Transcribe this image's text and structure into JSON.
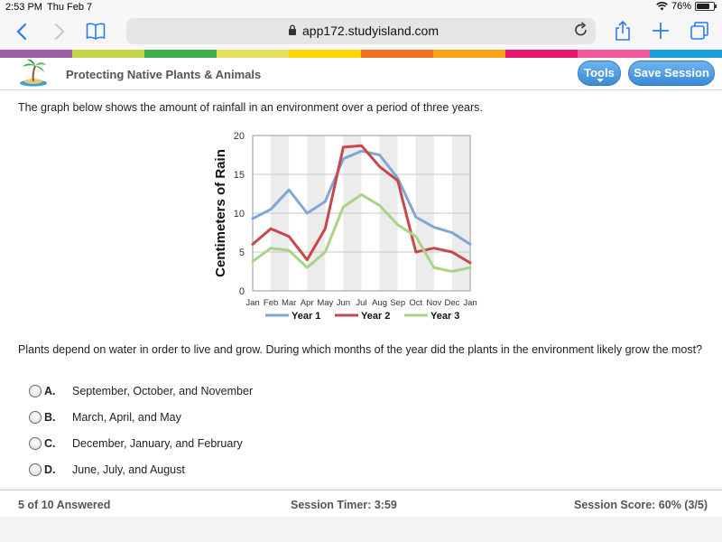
{
  "status": {
    "time": "2:53 PM",
    "date": "Thu Feb 7",
    "battery": "76%",
    "battery_level": 0.76
  },
  "browser": {
    "url": "app172.studyisland.com"
  },
  "stripe_colors": [
    "#9f5fa8",
    "#c5d649",
    "#3cb04a",
    "#e6e35b",
    "#ffd500",
    "#f37021",
    "#f7a21b",
    "#e6196e",
    "#f05a9b",
    "#1aa0d8"
  ],
  "app": {
    "title": "Protecting Native Plants & Animals",
    "tools_label": "Tools",
    "save_label": "Save Session"
  },
  "question": {
    "intro": "The graph below shows the amount of rainfall in an environment over a period of three years.",
    "prompt": "Plants depend on water in order to live and grow. During which months of the year did the plants in the environment likely grow the most?",
    "choices": [
      {
        "letter": "A.",
        "text": "September, October, and November"
      },
      {
        "letter": "B.",
        "text": "March, April, and May"
      },
      {
        "letter": "C.",
        "text": "December, January, and February"
      },
      {
        "letter": "D.",
        "text": "June, July, and August"
      }
    ]
  },
  "chart_data": {
    "type": "line",
    "categories": [
      "Jan",
      "Feb",
      "Mar",
      "Apr",
      "May",
      "Jun",
      "Jul",
      "Aug",
      "Sep",
      "Oct",
      "Nov",
      "Dec",
      "Jan"
    ],
    "ylabel": "Centimeters of Rain",
    "xlabel": "",
    "ylim": [
      0,
      20
    ],
    "yticks": [
      0,
      5,
      10,
      15,
      20
    ],
    "grid": true,
    "legend": "bottom",
    "series": [
      {
        "name": "Year 1",
        "color": "#7fa6d6",
        "values": [
          9.3,
          10.5,
          13,
          10,
          11.5,
          17,
          18,
          17.5,
          14.5,
          9.5,
          8.2,
          7.5,
          6
        ]
      },
      {
        "name": "Year 2",
        "color": "#c8474b",
        "values": [
          6,
          8,
          7,
          4,
          8,
          18.5,
          18.7,
          16,
          14.2,
          5,
          5.5,
          5,
          3.6
        ]
      },
      {
        "name": "Year 3",
        "color": "#a8d487",
        "values": [
          3.8,
          5.5,
          5.2,
          3,
          5,
          10.8,
          12.4,
          11,
          8.5,
          7,
          3,
          2.5,
          3
        ]
      }
    ]
  },
  "footer": {
    "answered": "5 of 10 Answered",
    "timer": "Session Timer: 3:59",
    "score": "Session Score: 60% (3/5)"
  }
}
